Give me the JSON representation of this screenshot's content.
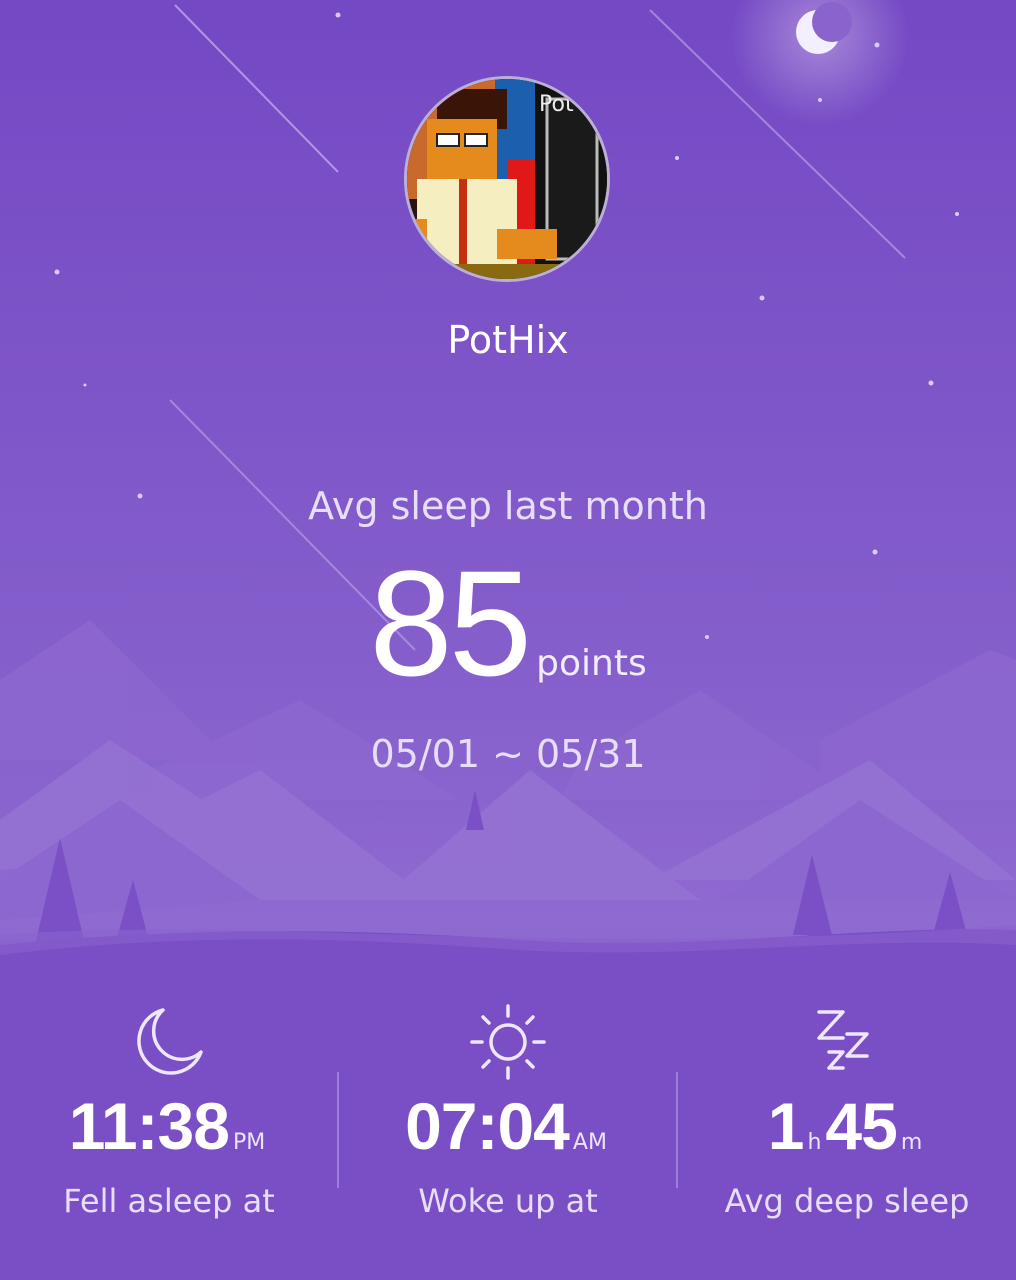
{
  "colors": {
    "background_top": "#7a4cc6",
    "background_mid": "#8d66cf",
    "ground": "#7a4fc5",
    "mountain": "#8b63cc",
    "text_muted": "#e8defa"
  },
  "profile": {
    "username": "PotHix",
    "avatar_icon": "pixel-art-avatar",
    "avatar_text": "Pot"
  },
  "summary": {
    "label": "Avg sleep last month",
    "score": "85",
    "score_unit": "points",
    "date_range": "05/01 ~ 05/31"
  },
  "stats": [
    {
      "icon": "moon-icon",
      "value": "11:38",
      "unit": "PM",
      "label": "Fell asleep at"
    },
    {
      "icon": "sun-icon",
      "value": "07:04",
      "unit": "AM",
      "label": "Woke up at"
    },
    {
      "icon": "zzz-icon",
      "hours": "1",
      "hours_unit": "h",
      "minutes": "45",
      "minutes_unit": "m",
      "label": "Avg deep sleep"
    }
  ]
}
